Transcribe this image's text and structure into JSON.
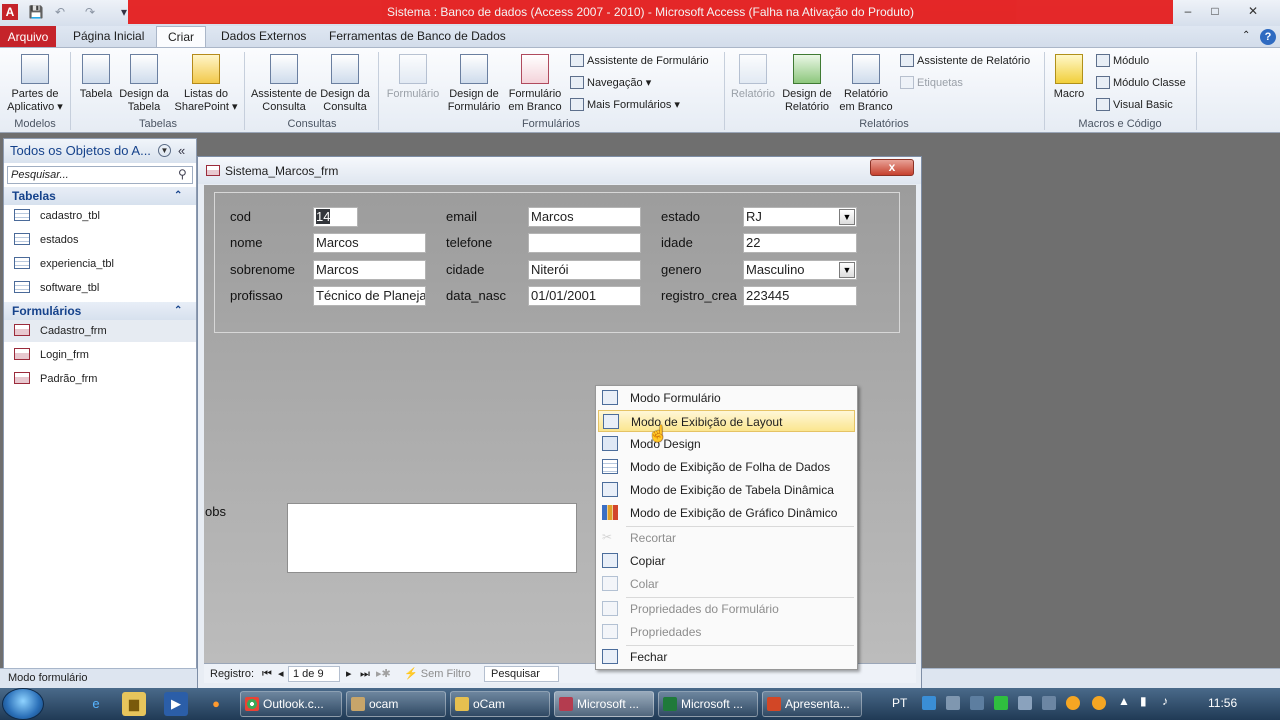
{
  "window": {
    "title": "Sistema : Banco de dados (Access 2007 - 2010)  -  Microsoft Access (Falha na Ativação do Produto)",
    "minimize": "–",
    "maximize": "□",
    "close": "✕",
    "app_icon": "A"
  },
  "ribbon_tabs": [
    "Arquivo",
    "Página Inicial",
    "Criar",
    "Dados Externos",
    "Ferramentas de Banco de Dados"
  ],
  "ribbon": {
    "modelos": {
      "partes": "Partes de Aplicativo ▾",
      "group": "Modelos"
    },
    "tabelas": {
      "tabela": "Tabela",
      "design_tabela": "Design da Tabela",
      "listas": "Listas do SharePoint ▾",
      "group": "Tabelas"
    },
    "consultas": {
      "assistente": "Assistente de Consulta",
      "design": "Design da Consulta",
      "group": "Consultas"
    },
    "formularios": {
      "formulario": "Formulário",
      "design": "Design de Formulário",
      "branco": "Formulário em Branco",
      "assistente": "Assistente de Formulário",
      "navegacao": "Navegação ▾",
      "mais": "Mais Formulários ▾",
      "group": "Formulários"
    },
    "relatorios": {
      "relatorio": "Relatório",
      "design": "Design de Relatório",
      "branco": "Relatório em Branco",
      "assistente": "Assistente de Relatório",
      "etiquetas": "Etiquetas",
      "group": "Relatórios"
    },
    "macros": {
      "macro": "Macro",
      "modulo": "Módulo",
      "modulo_classe": "Módulo Classe",
      "visual_basic": "Visual Basic",
      "group": "Macros e Código"
    }
  },
  "nav_pane": {
    "header": "Todos os Objetos do A...",
    "search_placeholder": "Pesquisar...",
    "sections": [
      {
        "title": "Tabelas",
        "items": [
          "cadastro_tbl",
          "estados",
          "experiencia_tbl",
          "software_tbl"
        ]
      },
      {
        "title": "Formulários",
        "items": [
          "Cadastro_frm",
          "Login_frm",
          "Padrão_frm"
        ]
      }
    ]
  },
  "form": {
    "title": "Sistema_Marcos_frm",
    "close": "x",
    "fields": {
      "cod": {
        "label": "cod",
        "value": "14"
      },
      "nome": {
        "label": "nome",
        "value": "Marcos"
      },
      "sobrenome": {
        "label": "sobrenome",
        "value": "Marcos"
      },
      "profissao": {
        "label": "profissao",
        "value": "Técnico de Planeja"
      },
      "email": {
        "label": "email",
        "value": "Marcos"
      },
      "telefone": {
        "label": "telefone",
        "value": ""
      },
      "cidade": {
        "label": "cidade",
        "value": "Niterói"
      },
      "data_nasc": {
        "label": "data_nasc",
        "value": "01/01/2001"
      },
      "estado": {
        "label": "estado",
        "value": "RJ"
      },
      "idade": {
        "label": "idade",
        "value": "22"
      },
      "genero": {
        "label": "genero",
        "value": "Masculino"
      },
      "registro_crea": {
        "label": "registro_crea",
        "value": "223445"
      }
    },
    "obs_label": "obs",
    "record_nav": {
      "label": "Registro:",
      "position": "1 de 9",
      "filter": "Sem Filtro",
      "search": "Pesquisar"
    }
  },
  "context_menu": {
    "items": [
      {
        "label": "Modo Formulário",
        "icon": "form-view-icon",
        "enabled": true
      },
      {
        "label": "Modo de Exibição de Layout",
        "icon": "layout-view-icon",
        "enabled": true,
        "highlighted": true
      },
      {
        "label": "Modo Design",
        "icon": "design-view-icon",
        "enabled": true
      },
      {
        "label": "Modo de Exibição de Folha de Dados",
        "icon": "datasheet-view-icon",
        "enabled": true
      },
      {
        "label": "Modo de Exibição de Tabela Dinâmica",
        "icon": "pivot-table-icon",
        "enabled": true
      },
      {
        "label": "Modo de Exibição de Gráfico Dinâmico",
        "icon": "pivot-chart-icon",
        "enabled": true
      },
      {
        "label": "Recortar",
        "icon": "cut-icon",
        "enabled": false
      },
      {
        "label": "Copiar",
        "icon": "copy-icon",
        "enabled": true
      },
      {
        "label": "Colar",
        "icon": "paste-icon",
        "enabled": false
      },
      {
        "label": "Propriedades do Formulário",
        "icon": "form-properties-icon",
        "enabled": false
      },
      {
        "label": "Propriedades",
        "icon": "properties-icon",
        "enabled": false
      },
      {
        "label": "Fechar",
        "icon": "close-form-icon",
        "enabled": true
      }
    ]
  },
  "status_bar": {
    "text": "Modo formulário"
  },
  "taskbar": {
    "buttons": [
      "Outlook.c...",
      "ocam",
      "oCam",
      "Microsoft ...",
      "Microsoft ...",
      "Apresenta..."
    ],
    "language": "PT",
    "clock": "11:56"
  },
  "colors": {
    "accent": "#c5232a",
    "title_red": "#e41d1d",
    "highlight": "#fbe68f"
  }
}
